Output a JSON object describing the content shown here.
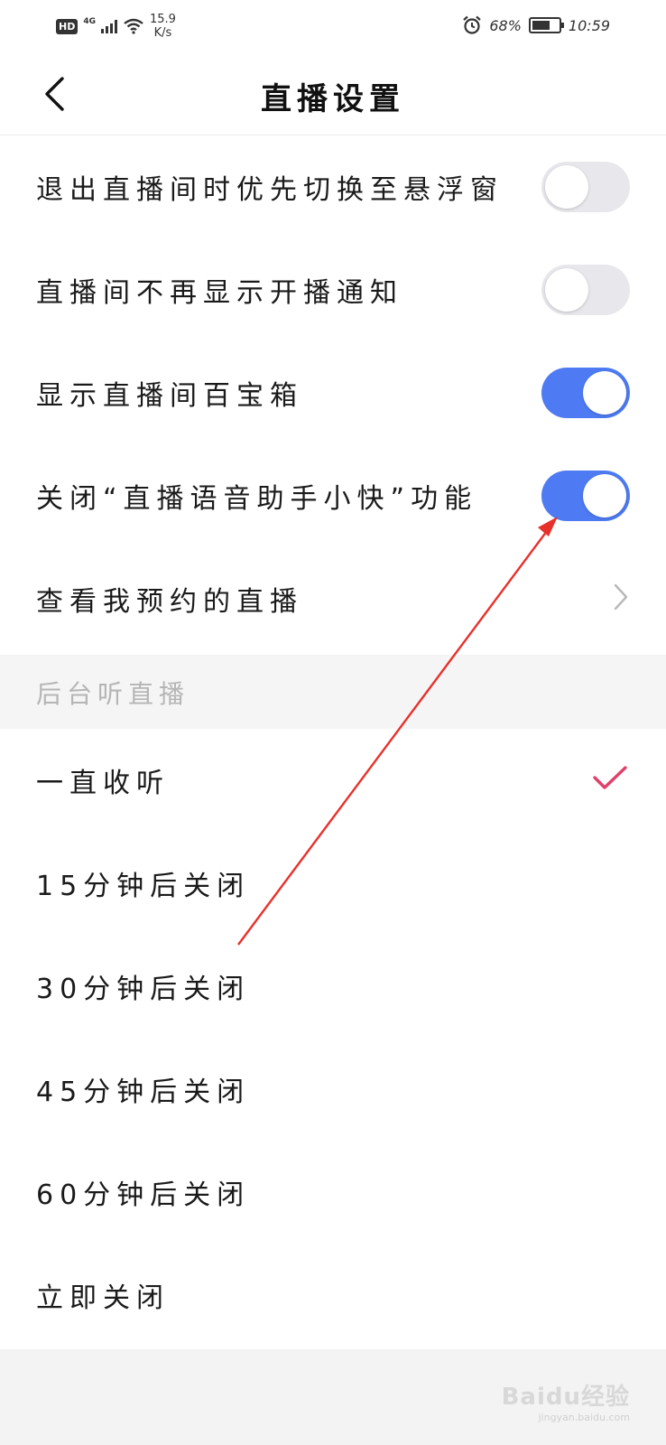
{
  "status_bar": {
    "hd": "HD",
    "network": "4G",
    "speed_value": "15.9",
    "speed_unit": "K/s",
    "battery": "68%",
    "time": "10:59",
    "battery_level": 0.68
  },
  "header": {
    "title": "直播设置",
    "back_icon": "chevron-left-icon"
  },
  "settings": [
    {
      "label": "退出直播间时优先切换至悬浮窗",
      "type": "toggle",
      "on": false
    },
    {
      "label": "直播间不再显示开播通知",
      "type": "toggle",
      "on": false
    },
    {
      "label": "显示直播间百宝箱",
      "type": "toggle",
      "on": true
    },
    {
      "label": "关闭“直播语音助手小快”功能",
      "type": "toggle",
      "on": true
    },
    {
      "label": "查看我预约的直播",
      "type": "link",
      "icon": "chevron-right-icon"
    }
  ],
  "background_listen": {
    "section_title": "后台听直播",
    "options": [
      {
        "label": "一直收听",
        "selected": true
      },
      {
        "label": "15分钟后关闭",
        "selected": false
      },
      {
        "label": "30分钟后关闭",
        "selected": false
      },
      {
        "label": "45分钟后关闭",
        "selected": false
      },
      {
        "label": "60分钟后关闭",
        "selected": false
      },
      {
        "label": "立即关闭",
        "selected": false
      }
    ]
  },
  "watermark": {
    "brand": "Baidu经验",
    "site": "jingyan.baidu.com"
  },
  "colors": {
    "toggle_on": "#4e7bf3",
    "toggle_off": "#e8e8ec",
    "check": "#e0406a",
    "annotation_arrow": "#e8302a"
  }
}
